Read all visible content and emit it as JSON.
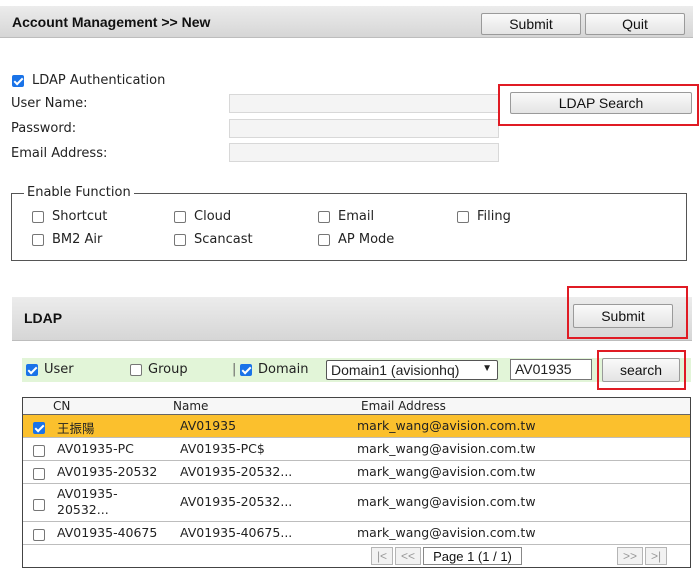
{
  "header": {
    "title": "Account Management >> New",
    "submit_label": "Submit",
    "quit_label": "Quit"
  },
  "form": {
    "ldap_auth_label": "LDAP Authentication",
    "ldap_auth_checked": true,
    "user_name_label": "User Name:",
    "password_label": "Password:",
    "email_label": "Email Address:",
    "ldap_search_label": "LDAP Search"
  },
  "functions": {
    "legend": "Enable Function",
    "items": [
      {
        "label": "Shortcut",
        "checked": false
      },
      {
        "label": "Cloud",
        "checked": false
      },
      {
        "label": "Email",
        "checked": false
      },
      {
        "label": "Filing",
        "checked": false
      },
      {
        "label": "BM2 Air",
        "checked": false
      },
      {
        "label": "Scancast",
        "checked": false
      },
      {
        "label": "AP Mode",
        "checked": false
      }
    ]
  },
  "ldap": {
    "title": "LDAP",
    "submit_label": "Submit",
    "filter": {
      "user_label": "User",
      "user_checked": true,
      "group_label": "Group",
      "group_checked": false,
      "separator": "|",
      "domain_label": "Domain",
      "domain_checked": true,
      "domain_select": "Domain1 (avisionhq)",
      "search_value": "AV01935",
      "search_button": "search"
    },
    "columns": [
      "CN",
      "Name",
      "Email Address"
    ],
    "rows": [
      {
        "cn": "王振陽",
        "name": "AV01935",
        "email": "mark_wang@avision.com.tw",
        "checked": true
      },
      {
        "cn": "AV01935-PC",
        "name": "AV01935-PC$",
        "email": "mark_wang@avision.com.tw",
        "checked": false
      },
      {
        "cn": "AV01935-20532",
        "name": "AV01935-20532...",
        "email": "mark_wang@avision.com.tw",
        "checked": false
      },
      {
        "cn": "AV01935-",
        "cn2": "20532...",
        "name": "AV01935-20532...",
        "email": "mark_wang@avision.com.tw",
        "checked": false
      },
      {
        "cn": "AV01935-40675",
        "name": "AV01935-40675...",
        "email": "mark_wang@avision.com.tw",
        "checked": false
      }
    ],
    "pager": {
      "first": "|<",
      "prev": "<<",
      "page_text": "Page 1 (1 / 1)",
      "next": ">>",
      "last": ">|"
    }
  },
  "colors": {
    "highlight": "#e01b24",
    "selected_row": "#fbc02d",
    "filter_bar": "#e2f5d8",
    "checkbox": "#1a73e8"
  }
}
